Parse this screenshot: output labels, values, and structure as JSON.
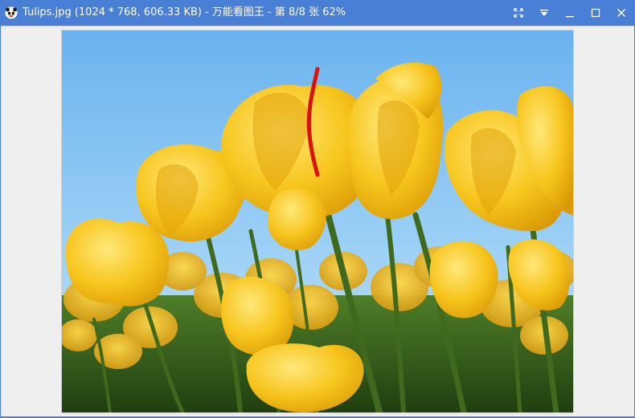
{
  "window": {
    "title": "Tulips.jpg (1024 * 768, 606.33 KB) - 万能看图王 - 第 8/8 张 62%",
    "app_icon": "panda-app-icon",
    "accent_color": "#4a7fd6"
  },
  "controls": [
    {
      "name": "fullscreen-button",
      "icon": "fullscreen-icon"
    },
    {
      "name": "menu-dropdown-button",
      "icon": "menu-dropdown-icon"
    },
    {
      "name": "minimize-button",
      "icon": "minimize-icon"
    },
    {
      "name": "maximize-button",
      "icon": "maximize-icon"
    },
    {
      "name": "close-button",
      "icon": "close-icon"
    }
  ],
  "image": {
    "subject": "tulips",
    "sky_color": "#7ec0f0",
    "petal_color": "#f5c21c",
    "stem_color": "#3f6a1e"
  }
}
